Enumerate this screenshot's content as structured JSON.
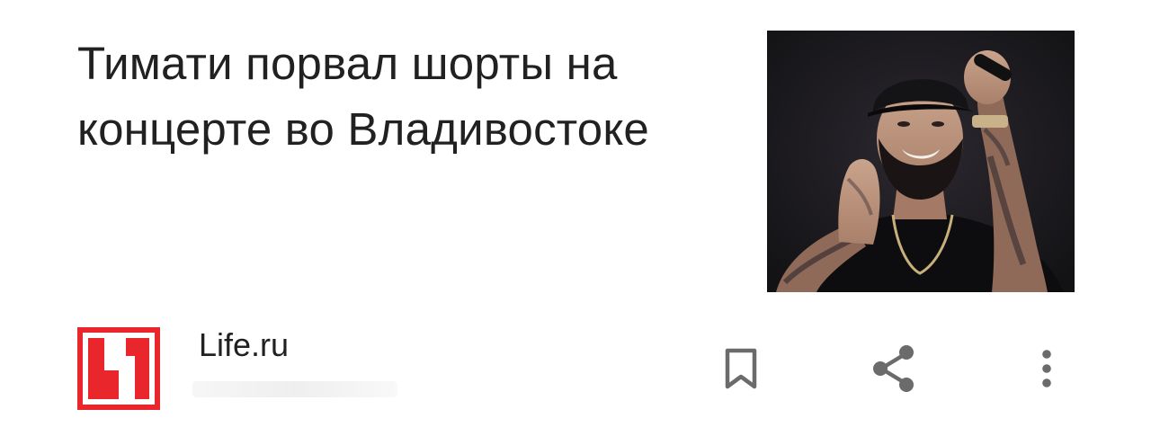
{
  "article": {
    "headline": "Тимати порвал шорты на концерте во Владивостоке",
    "thumbnail_icon": "photo-performer-on-stage"
  },
  "source": {
    "name": "Life.ru",
    "logo_icon": "life-logo",
    "logo_color": "#e8262b"
  },
  "actions": {
    "bookmark_icon": "bookmark-icon",
    "share_icon": "share-icon",
    "more_icon": "more-vert-icon",
    "icon_color": "#6b6b6b"
  }
}
